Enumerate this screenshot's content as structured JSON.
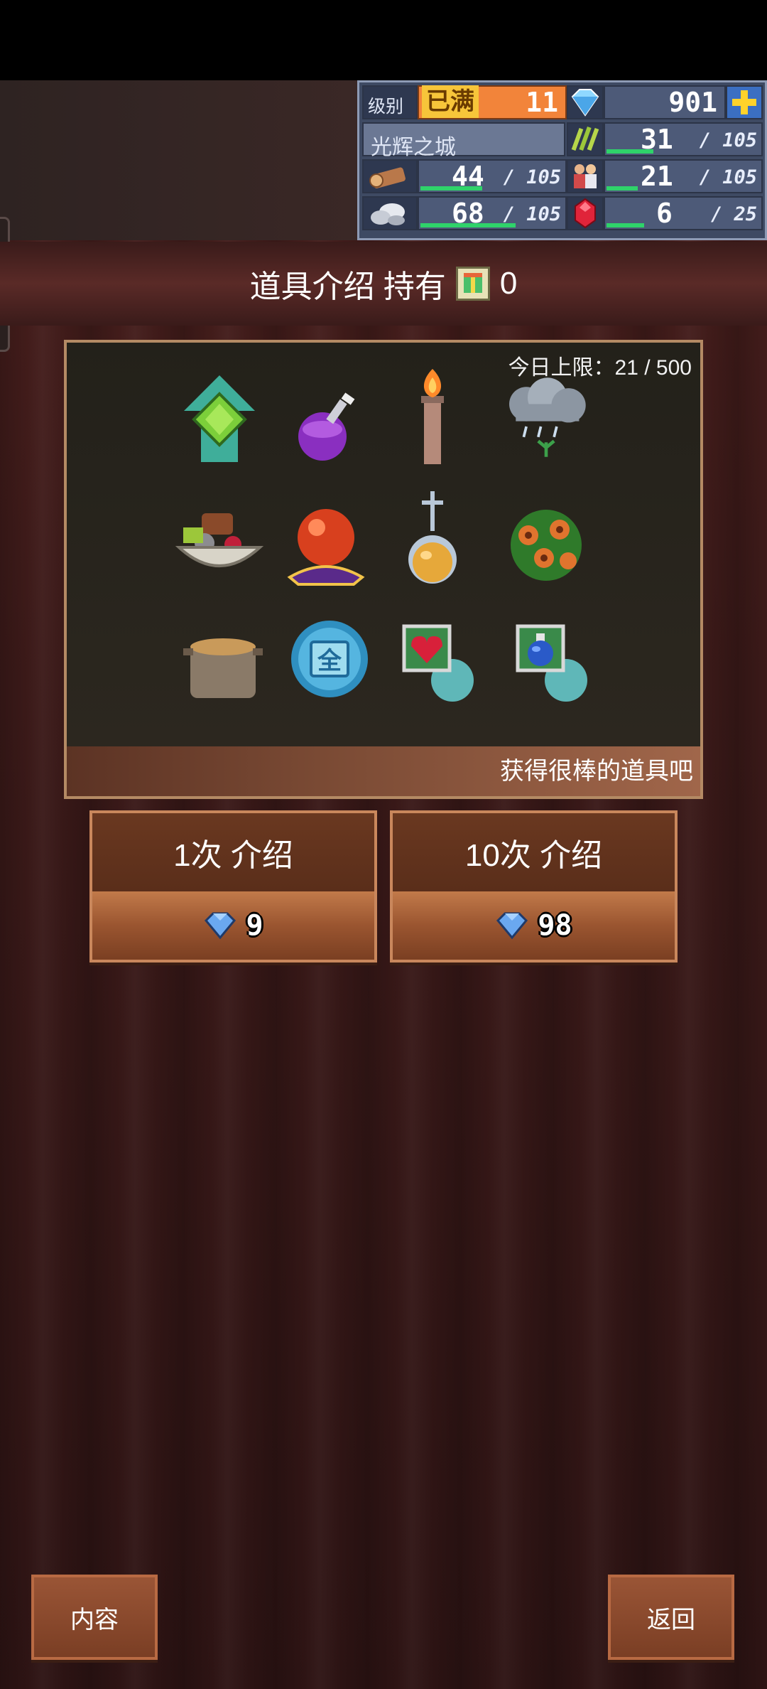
{
  "resources": {
    "level_label": "级别",
    "level_badge": "已满",
    "level_value": "11",
    "gems": "901",
    "town_name": "光辉之城",
    "food": {
      "value": "31",
      "max": "105",
      "fill": 0.3
    },
    "wood": {
      "value": "44",
      "max": "105",
      "fill": 0.42
    },
    "workers": {
      "value": "21",
      "max": "105",
      "fill": 0.2
    },
    "stone": {
      "value": "68",
      "max": "105",
      "fill": 0.65
    },
    "ruby": {
      "value": "6",
      "max": "25",
      "fill": 0.24
    }
  },
  "header": {
    "title": "道具介绍 持有",
    "count": "0"
  },
  "showcase": {
    "daily_limit": "今日上限：21 / 500",
    "footer": "获得很棒的道具吧",
    "items": [
      "green-gem-arrow",
      "purple-potion",
      "torch",
      "rain-cloud",
      "food-basket",
      "crystal-ball",
      "golden-flask",
      "flower-bush",
      "soup-pot",
      "blue-coin",
      "heart-card",
      "potion-card"
    ],
    "item_glyphs": {
      "blue-coin": "全"
    }
  },
  "buttons": {
    "single": {
      "label": "1次 介绍",
      "cost": "9"
    },
    "ten": {
      "label": "10次 介绍",
      "cost": "98"
    }
  },
  "footer": {
    "content": "内容",
    "back": "返回"
  },
  "colors": {
    "accent": "#2fd36a",
    "panel": "#3e4a63",
    "level": "#f2843a"
  }
}
